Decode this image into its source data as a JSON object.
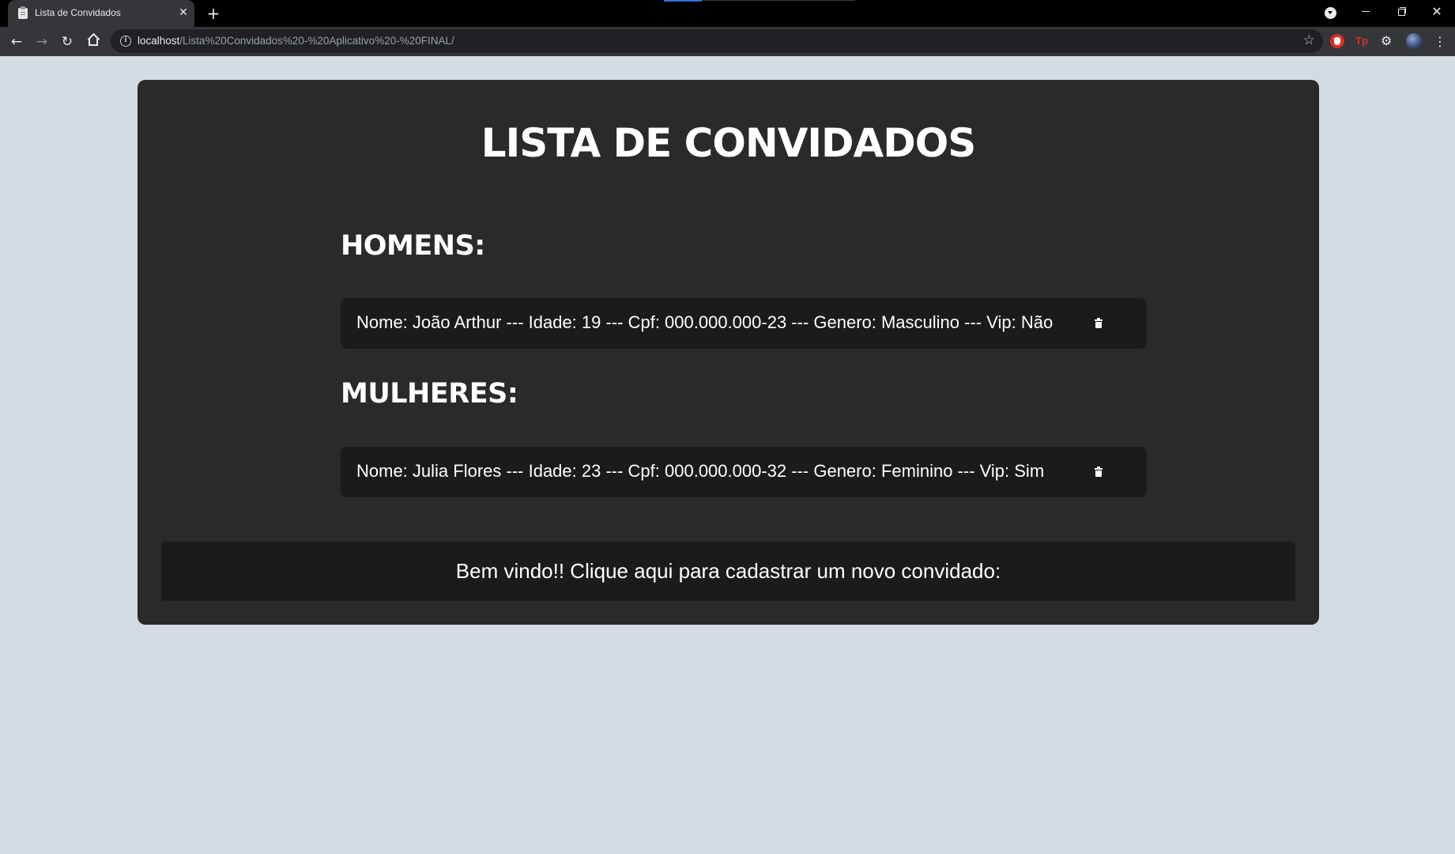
{
  "browser": {
    "tab": {
      "title": "Lista de Convidados"
    },
    "new_tab_label": "+",
    "address": {
      "host": "localhost",
      "path": "/Lista%20Convidados%20-%20Aplicativo%20-%20FINAL/"
    },
    "window_controls": {
      "minimize": "",
      "maximize": "",
      "close": "✕"
    },
    "extensions": [
      {
        "icon": "adblock-icon"
      },
      {
        "icon": "tp-extension-icon",
        "label": "Tp"
      },
      {
        "icon": "puzzle-extensions-icon"
      }
    ],
    "icons": {
      "back": "arrow-left-icon",
      "forward": "arrow-right-icon",
      "reload": "reload-icon",
      "home": "home-icon",
      "info": "info-icon",
      "bookmark": "star-icon",
      "menu": "kebab-menu-icon"
    }
  },
  "page": {
    "title": "LISTA DE CONVIDADOS",
    "sections": {
      "men": {
        "heading": "HOMENS:",
        "guests": [
          {
            "text": "Nome: João Arthur --- Idade: 19 --- Cpf: 000.000.000-23 --- Genero: Masculino --- Vip: Não"
          }
        ]
      },
      "women": {
        "heading": "MULHERES:",
        "guests": [
          {
            "text": "Nome: Julia Flores --- Idade: 23 --- Cpf: 000.000.000-32 --- Genero: Feminino --- Vip: Sim"
          }
        ]
      }
    },
    "welcome_banner": "Bem vindo!! Clique aqui para cadastrar um novo convidado:"
  },
  "colors": {
    "page_background": "#d3dae2",
    "card_background": "#2a292b",
    "row_background": "#1b1a1c",
    "text": "#ffffff"
  }
}
